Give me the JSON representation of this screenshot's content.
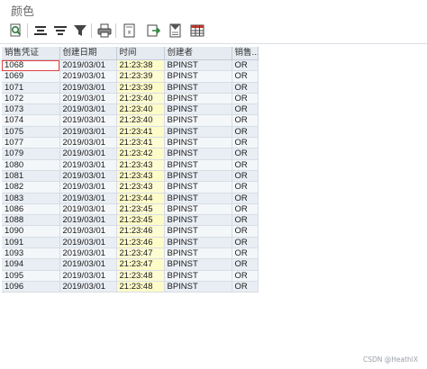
{
  "window": {
    "title": "颜色"
  },
  "toolbar": {
    "buttons": [
      {
        "icon": "magnify-detail-icon"
      },
      {
        "icon": "sort-ascending-icon"
      },
      {
        "icon": "sort-descending-icon"
      },
      {
        "icon": "filter-icon"
      },
      {
        "icon": "print-icon"
      },
      {
        "icon": "export-excel-icon"
      },
      {
        "icon": "export-file-icon"
      },
      {
        "icon": "column-settings-icon"
      },
      {
        "icon": "layout-grid-icon"
      }
    ]
  },
  "table": {
    "headers": [
      "销售凭证",
      "创建日期",
      "时间",
      "创建者",
      "销售..."
    ],
    "rows": [
      [
        "1068",
        "2019/03/01",
        "21:23:38",
        "BPINST",
        "OR"
      ],
      [
        "1069",
        "2019/03/01",
        "21:23:39",
        "BPINST",
        "OR"
      ],
      [
        "1071",
        "2019/03/01",
        "21:23:39",
        "BPINST",
        "OR"
      ],
      [
        "1072",
        "2019/03/01",
        "21:23:40",
        "BPINST",
        "OR"
      ],
      [
        "1073",
        "2019/03/01",
        "21:23:40",
        "BPINST",
        "OR"
      ],
      [
        "1074",
        "2019/03/01",
        "21:23:40",
        "BPINST",
        "OR"
      ],
      [
        "1075",
        "2019/03/01",
        "21:23:41",
        "BPINST",
        "OR"
      ],
      [
        "1077",
        "2019/03/01",
        "21:23:41",
        "BPINST",
        "OR"
      ],
      [
        "1079",
        "2019/03/01",
        "21:23:42",
        "BPINST",
        "OR"
      ],
      [
        "1080",
        "2019/03/01",
        "21:23:43",
        "BPINST",
        "OR"
      ],
      [
        "1081",
        "2019/03/01",
        "21:23:43",
        "BPINST",
        "OR"
      ],
      [
        "1082",
        "2019/03/01",
        "21:23:43",
        "BPINST",
        "OR"
      ],
      [
        "1083",
        "2019/03/01",
        "21:23:44",
        "BPINST",
        "OR"
      ],
      [
        "1086",
        "2019/03/01",
        "21:23:45",
        "BPINST",
        "OR"
      ],
      [
        "1088",
        "2019/03/01",
        "21:23:45",
        "BPINST",
        "OR"
      ],
      [
        "1090",
        "2019/03/01",
        "21:23:46",
        "BPINST",
        "OR"
      ],
      [
        "1091",
        "2019/03/01",
        "21:23:46",
        "BPINST",
        "OR"
      ],
      [
        "1093",
        "2019/03/01",
        "21:23:47",
        "BPINST",
        "OR"
      ],
      [
        "1094",
        "2019/03/01",
        "21:23:47",
        "BPINST",
        "OR"
      ],
      [
        "1095",
        "2019/03/01",
        "21:23:48",
        "BPINST",
        "OR"
      ],
      [
        "1096",
        "2019/03/01",
        "21:23:48",
        "BPINST",
        "OR"
      ]
    ]
  },
  "watermark": "CSDN @HeathlX",
  "colors": {
    "time_column_bg": "#fdfbc8",
    "header_bg": "#e6ebf1",
    "row_bg": "#e9eef4"
  }
}
